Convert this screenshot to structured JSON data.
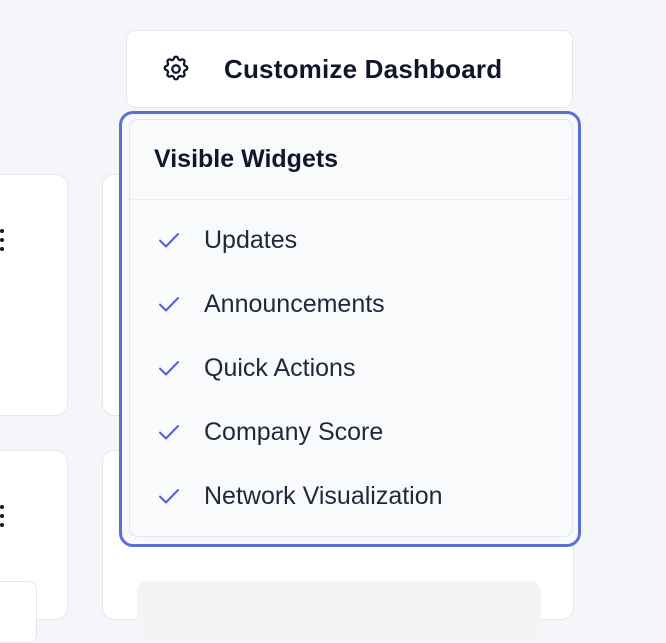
{
  "toolbar": {
    "customize_label": "Customize Dashboard",
    "icon": "gear-icon"
  },
  "dropdown": {
    "title": "Visible Widgets",
    "items": [
      {
        "label": "Updates",
        "checked": true
      },
      {
        "label": "Announcements",
        "checked": true
      },
      {
        "label": "Quick Actions",
        "checked": true
      },
      {
        "label": "Company Score",
        "checked": true
      },
      {
        "label": "Network Visualization",
        "checked": true
      }
    ]
  },
  "colors": {
    "accent": "#5b6fd8",
    "check": "#4f63d2",
    "background": "#f5f6f9"
  }
}
